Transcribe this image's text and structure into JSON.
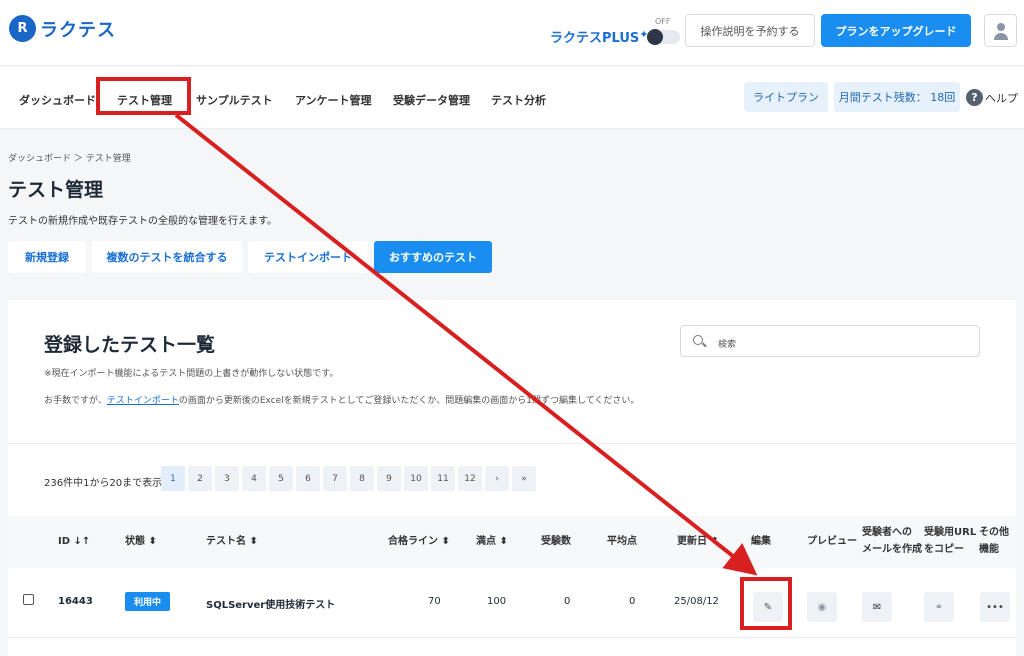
{
  "header": {
    "logo_mark": "R",
    "logo_text": "ラクテス",
    "plus_label": "ラクテスPLUS",
    "plus_star": "✦",
    "toggle_state": "OFF",
    "reserve_button": "操作説明を予約する",
    "upgrade_button": "プランをアップグレード"
  },
  "nav": {
    "items": [
      "ダッシュボード",
      "テスト管理",
      "サンプルテスト",
      "アンケート管理",
      "受験データ管理",
      "テスト分析"
    ],
    "plan": "ライトプラン",
    "remaining": "月間テスト残数： 18回",
    "help": "ヘルプ",
    "help_icon": "?"
  },
  "page": {
    "breadcrumb": "ダッシュボード ＞ テスト管理",
    "title": "テスト管理",
    "description": "テストの新規作成や既存テストの全般的な管理を行えます。",
    "actions": [
      "新規登録",
      "複数のテストを統合する",
      "テストインポート",
      "おすすめのテスト"
    ]
  },
  "list": {
    "title": "登録したテスト一覧",
    "note1": "※現在インポート機能によるテスト問題の上書きが動作しない状態です。",
    "note2_prefix": "お手数ですが、",
    "note2_link": "テストインポート",
    "note2_suffix": "の画面から更新後のExcelを新規テストとしてご登録いただくか、問題編集の画面から1問ずつ編集してください。",
    "search_placeholder": "検索",
    "pager_info": "236件中1から20まで表示",
    "pages": [
      "1",
      "2",
      "3",
      "4",
      "5",
      "6",
      "7",
      "8",
      "9",
      "10",
      "11",
      "12",
      "›",
      "»"
    ],
    "columns": {
      "id": "ID ↓↑",
      "status": "状態 ⬍",
      "name": "テスト名 ⬍",
      "pass_line": "合格ライン ⬍",
      "full_score": "満点 ⬍",
      "examinees": "受験数",
      "average": "平均点",
      "updated": "更新日 ⬍",
      "edit": "編集",
      "preview": "プレビュー",
      "mail_line1": "受験者への",
      "mail_line2": "メールを作成",
      "url_line1": "受験用URL",
      "url_line2": "をコピー",
      "other_line1": "その他",
      "other_line2": "機能"
    },
    "rows": [
      {
        "id": "16443",
        "status": "利用中",
        "name": "SQLServer使用技術テスト",
        "pass_line": "70",
        "full_score": "100",
        "examinees": "0",
        "average": "0",
        "updated": "25/08/12",
        "edit_icon": "✎",
        "preview_icon": "◉",
        "mail_icon": "✉",
        "link_icon": "⚭",
        "more_icon": "•••"
      }
    ]
  },
  "colors": {
    "accent": "#1a8ef0",
    "annotation": "#d92020"
  }
}
